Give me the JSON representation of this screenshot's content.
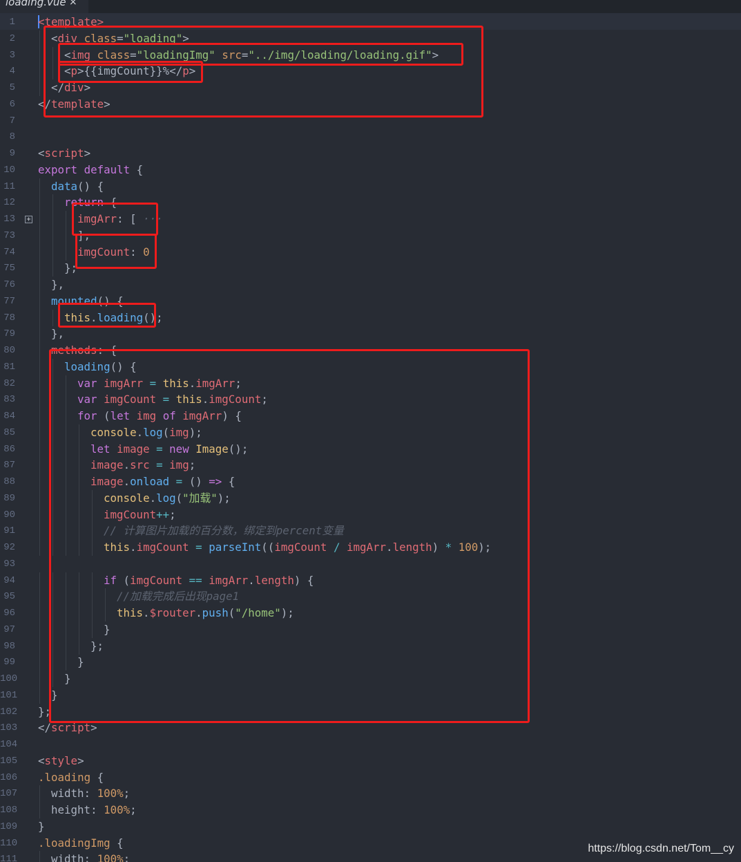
{
  "tab": {
    "file_name": "loading.vue",
    "close_glyph": "×"
  },
  "theme": {
    "tag": "#e06c75",
    "attr": "#d19a66",
    "string": "#98c379",
    "keyword": "#c678dd",
    "func": "#61afef",
    "comment": "#5c6370",
    "number": "#d19a66",
    "plain": "#abb2bf",
    "var": "#e06c75",
    "builtin": "#e5c07b",
    "operator": "#56b6c2",
    "class": "#d19a66",
    "highlight_box": "#ee1c1c"
  },
  "lines": [
    {
      "n": "1",
      "indent": 0,
      "tokens": [
        [
          "tag",
          "<template>"
        ]
      ]
    },
    {
      "n": "2",
      "indent": 1,
      "tokens": [
        [
          "plain",
          "<"
        ],
        [
          "tag",
          "div"
        ],
        [
          "plain",
          " "
        ],
        [
          "attr",
          "class"
        ],
        [
          "plain",
          "="
        ],
        [
          "string",
          "\"loading\""
        ],
        [
          "plain",
          ">"
        ]
      ]
    },
    {
      "n": "3",
      "indent": 2,
      "tokens": [
        [
          "plain",
          "<"
        ],
        [
          "tag",
          "img"
        ],
        [
          "plain",
          " "
        ],
        [
          "attr",
          "class"
        ],
        [
          "plain",
          "="
        ],
        [
          "string",
          "\"loadingImg\""
        ],
        [
          "plain",
          " "
        ],
        [
          "attr",
          "src"
        ],
        [
          "plain",
          "="
        ],
        [
          "string",
          "\"../img/loading/loading.gif\""
        ],
        [
          "plain",
          ">"
        ]
      ]
    },
    {
      "n": "4",
      "indent": 2,
      "tokens": [
        [
          "plain",
          "<"
        ],
        [
          "tag",
          "p"
        ],
        [
          "plain",
          ">"
        ],
        [
          "plain",
          "{{imgCount}}%"
        ],
        [
          "plain",
          "</"
        ],
        [
          "tag",
          "p"
        ],
        [
          "plain",
          ">"
        ]
      ]
    },
    {
      "n": "5",
      "indent": 1,
      "tokens": [
        [
          "plain",
          "</"
        ],
        [
          "tag",
          "div"
        ],
        [
          "plain",
          ">"
        ]
      ]
    },
    {
      "n": "6",
      "indent": 0,
      "tokens": [
        [
          "plain",
          "</"
        ],
        [
          "tag",
          "template"
        ],
        [
          "plain",
          ">"
        ]
      ]
    },
    {
      "n": "7",
      "indent": 0,
      "tokens": []
    },
    {
      "n": "8",
      "indent": 0,
      "tokens": []
    },
    {
      "n": "9",
      "indent": 0,
      "tokens": [
        [
          "plain",
          "<"
        ],
        [
          "tag",
          "script"
        ],
        [
          "plain",
          ">"
        ]
      ]
    },
    {
      "n": "10",
      "indent": 0,
      "tokens": [
        [
          "keyword",
          "export"
        ],
        [
          "plain",
          " "
        ],
        [
          "keyword",
          "default"
        ],
        [
          "plain",
          " {"
        ]
      ]
    },
    {
      "n": "11",
      "indent": 1,
      "tokens": [
        [
          "func",
          "data"
        ],
        [
          "plain",
          "() {"
        ]
      ]
    },
    {
      "n": "12",
      "indent": 2,
      "tokens": [
        [
          "keyword",
          "return"
        ],
        [
          "plain",
          " {"
        ]
      ]
    },
    {
      "n": "13",
      "indent": 3,
      "fold": true,
      "tokens": [
        [
          "var",
          "imgArr"
        ],
        [
          "plain",
          ": [ "
        ],
        [
          "comment",
          "···"
        ]
      ]
    },
    {
      "n": "73",
      "indent": 3,
      "tokens": [
        [
          "plain",
          "],"
        ]
      ]
    },
    {
      "n": "74",
      "indent": 3,
      "tokens": [
        [
          "var",
          "imgCount"
        ],
        [
          "plain",
          ": "
        ],
        [
          "number",
          "0"
        ]
      ]
    },
    {
      "n": "75",
      "indent": 2,
      "tokens": [
        [
          "plain",
          "};"
        ]
      ]
    },
    {
      "n": "76",
      "indent": 1,
      "tokens": [
        [
          "plain",
          "},"
        ]
      ]
    },
    {
      "n": "77",
      "indent": 1,
      "tokens": [
        [
          "func",
          "mounted"
        ],
        [
          "plain",
          "() {"
        ]
      ]
    },
    {
      "n": "78",
      "indent": 2,
      "tokens": [
        [
          "builtin",
          "this"
        ],
        [
          "plain",
          "."
        ],
        [
          "func",
          "loading"
        ],
        [
          "plain",
          "();"
        ]
      ]
    },
    {
      "n": "79",
      "indent": 1,
      "tokens": [
        [
          "plain",
          "},"
        ]
      ]
    },
    {
      "n": "80",
      "indent": 1,
      "tokens": [
        [
          "var",
          "methods"
        ],
        [
          "plain",
          ": {"
        ]
      ]
    },
    {
      "n": "81",
      "indent": 2,
      "tokens": [
        [
          "func",
          "loading"
        ],
        [
          "plain",
          "() {"
        ]
      ]
    },
    {
      "n": "82",
      "indent": 3,
      "tokens": [
        [
          "keyword",
          "var"
        ],
        [
          "plain",
          " "
        ],
        [
          "var",
          "imgArr"
        ],
        [
          "plain",
          " "
        ],
        [
          "operator",
          "="
        ],
        [
          "plain",
          " "
        ],
        [
          "builtin",
          "this"
        ],
        [
          "plain",
          "."
        ],
        [
          "var",
          "imgArr"
        ],
        [
          "plain",
          ";"
        ]
      ]
    },
    {
      "n": "83",
      "indent": 3,
      "tokens": [
        [
          "keyword",
          "var"
        ],
        [
          "plain",
          " "
        ],
        [
          "var",
          "imgCount"
        ],
        [
          "plain",
          " "
        ],
        [
          "operator",
          "="
        ],
        [
          "plain",
          " "
        ],
        [
          "builtin",
          "this"
        ],
        [
          "plain",
          "."
        ],
        [
          "var",
          "imgCount"
        ],
        [
          "plain",
          ";"
        ]
      ]
    },
    {
      "n": "84",
      "indent": 3,
      "tokens": [
        [
          "keyword",
          "for"
        ],
        [
          "plain",
          " ("
        ],
        [
          "keyword",
          "let"
        ],
        [
          "plain",
          " "
        ],
        [
          "var",
          "img"
        ],
        [
          "plain",
          " "
        ],
        [
          "keyword",
          "of"
        ],
        [
          "plain",
          " "
        ],
        [
          "var",
          "imgArr"
        ],
        [
          "plain",
          ") {"
        ]
      ]
    },
    {
      "n": "85",
      "indent": 4,
      "tokens": [
        [
          "builtin",
          "console"
        ],
        [
          "plain",
          "."
        ],
        [
          "func",
          "log"
        ],
        [
          "plain",
          "("
        ],
        [
          "var",
          "img"
        ],
        [
          "plain",
          ");"
        ]
      ]
    },
    {
      "n": "86",
      "indent": 4,
      "tokens": [
        [
          "keyword",
          "let"
        ],
        [
          "plain",
          " "
        ],
        [
          "var",
          "image"
        ],
        [
          "plain",
          " "
        ],
        [
          "operator",
          "="
        ],
        [
          "plain",
          " "
        ],
        [
          "keyword",
          "new"
        ],
        [
          "plain",
          " "
        ],
        [
          "builtin",
          "Image"
        ],
        [
          "plain",
          "();"
        ]
      ]
    },
    {
      "n": "87",
      "indent": 4,
      "tokens": [
        [
          "var",
          "image"
        ],
        [
          "plain",
          "."
        ],
        [
          "var",
          "src"
        ],
        [
          "plain",
          " "
        ],
        [
          "operator",
          "="
        ],
        [
          "plain",
          " "
        ],
        [
          "var",
          "img"
        ],
        [
          "plain",
          ";"
        ]
      ]
    },
    {
      "n": "88",
      "indent": 4,
      "tokens": [
        [
          "var",
          "image"
        ],
        [
          "plain",
          "."
        ],
        [
          "func",
          "onload"
        ],
        [
          "plain",
          " "
        ],
        [
          "operator",
          "="
        ],
        [
          "plain",
          " () "
        ],
        [
          "keyword",
          "=>"
        ],
        [
          "plain",
          " {"
        ]
      ]
    },
    {
      "n": "89",
      "indent": 5,
      "tokens": [
        [
          "builtin",
          "console"
        ],
        [
          "plain",
          "."
        ],
        [
          "func",
          "log"
        ],
        [
          "plain",
          "("
        ],
        [
          "string",
          "\"加载\""
        ],
        [
          "plain",
          ");"
        ]
      ]
    },
    {
      "n": "90",
      "indent": 5,
      "tokens": [
        [
          "var",
          "imgCount"
        ],
        [
          "operator",
          "++"
        ],
        [
          "plain",
          ";"
        ]
      ]
    },
    {
      "n": "91",
      "indent": 5,
      "tokens": [
        [
          "comment",
          "// 计算图片加载的百分数，绑定到percent变量"
        ]
      ]
    },
    {
      "n": "92",
      "indent": 5,
      "tokens": [
        [
          "builtin",
          "this"
        ],
        [
          "plain",
          "."
        ],
        [
          "var",
          "imgCount"
        ],
        [
          "plain",
          " "
        ],
        [
          "operator",
          "="
        ],
        [
          "plain",
          " "
        ],
        [
          "func",
          "parseInt"
        ],
        [
          "plain",
          "(("
        ],
        [
          "var",
          "imgCount"
        ],
        [
          "plain",
          " "
        ],
        [
          "operator",
          "/"
        ],
        [
          "plain",
          " "
        ],
        [
          "var",
          "imgArr"
        ],
        [
          "plain",
          "."
        ],
        [
          "var",
          "length"
        ],
        [
          "plain",
          ") "
        ],
        [
          "operator",
          "*"
        ],
        [
          "plain",
          " "
        ],
        [
          "number",
          "100"
        ],
        [
          "plain",
          ");"
        ]
      ]
    },
    {
      "n": "93",
      "indent": 0,
      "tokens": []
    },
    {
      "n": "94",
      "indent": 5,
      "tokens": [
        [
          "keyword",
          "if"
        ],
        [
          "plain",
          " ("
        ],
        [
          "var",
          "imgCount"
        ],
        [
          "plain",
          " "
        ],
        [
          "operator",
          "=="
        ],
        [
          "plain",
          " "
        ],
        [
          "var",
          "imgArr"
        ],
        [
          "plain",
          "."
        ],
        [
          "var",
          "length"
        ],
        [
          "plain",
          ") {"
        ]
      ]
    },
    {
      "n": "95",
      "indent": 6,
      "tokens": [
        [
          "comment",
          "//加载完成后出现page1"
        ]
      ]
    },
    {
      "n": "96",
      "indent": 6,
      "tokens": [
        [
          "builtin",
          "this"
        ],
        [
          "plain",
          "."
        ],
        [
          "var",
          "$router"
        ],
        [
          "plain",
          "."
        ],
        [
          "func",
          "push"
        ],
        [
          "plain",
          "("
        ],
        [
          "string",
          "\"/home\""
        ],
        [
          "plain",
          ");"
        ]
      ]
    },
    {
      "n": "97",
      "indent": 5,
      "tokens": [
        [
          "plain",
          "}"
        ]
      ]
    },
    {
      "n": "98",
      "indent": 4,
      "tokens": [
        [
          "plain",
          "};"
        ]
      ]
    },
    {
      "n": "99",
      "indent": 3,
      "tokens": [
        [
          "plain",
          "}"
        ]
      ]
    },
    {
      "n": "100",
      "indent": 2,
      "tokens": [
        [
          "plain",
          "}"
        ]
      ]
    },
    {
      "n": "101",
      "indent": 1,
      "tokens": [
        [
          "plain",
          "}"
        ]
      ]
    },
    {
      "n": "102",
      "indent": 0,
      "tokens": [
        [
          "plain",
          "};"
        ]
      ]
    },
    {
      "n": "103",
      "indent": 0,
      "tokens": [
        [
          "plain",
          "</"
        ],
        [
          "tag",
          "script"
        ],
        [
          "plain",
          ">"
        ]
      ]
    },
    {
      "n": "104",
      "indent": 0,
      "tokens": []
    },
    {
      "n": "105",
      "indent": 0,
      "tokens": [
        [
          "plain",
          "<"
        ],
        [
          "tag",
          "style"
        ],
        [
          "plain",
          ">"
        ]
      ]
    },
    {
      "n": "106",
      "indent": 0,
      "tokens": [
        [
          "class",
          ".loading"
        ],
        [
          "plain",
          " {"
        ]
      ]
    },
    {
      "n": "107",
      "indent": 1,
      "tokens": [
        [
          "plain",
          "width: "
        ],
        [
          "number",
          "100%"
        ],
        [
          "plain",
          ";"
        ]
      ]
    },
    {
      "n": "108",
      "indent": 1,
      "tokens": [
        [
          "plain",
          "height: "
        ],
        [
          "number",
          "100%"
        ],
        [
          "plain",
          ";"
        ]
      ]
    },
    {
      "n": "109",
      "indent": 0,
      "tokens": [
        [
          "plain",
          "}"
        ]
      ]
    },
    {
      "n": "110",
      "indent": 0,
      "tokens": [
        [
          "class",
          ".loadingImg"
        ],
        [
          "plain",
          " {"
        ]
      ]
    },
    {
      "n": "111",
      "indent": 1,
      "tokens": [
        [
          "plain",
          "width: "
        ],
        [
          "number",
          "100%"
        ],
        [
          "plain",
          ";"
        ]
      ]
    }
  ],
  "watermark": "https://blog.csdn.net/Tom__cy"
}
